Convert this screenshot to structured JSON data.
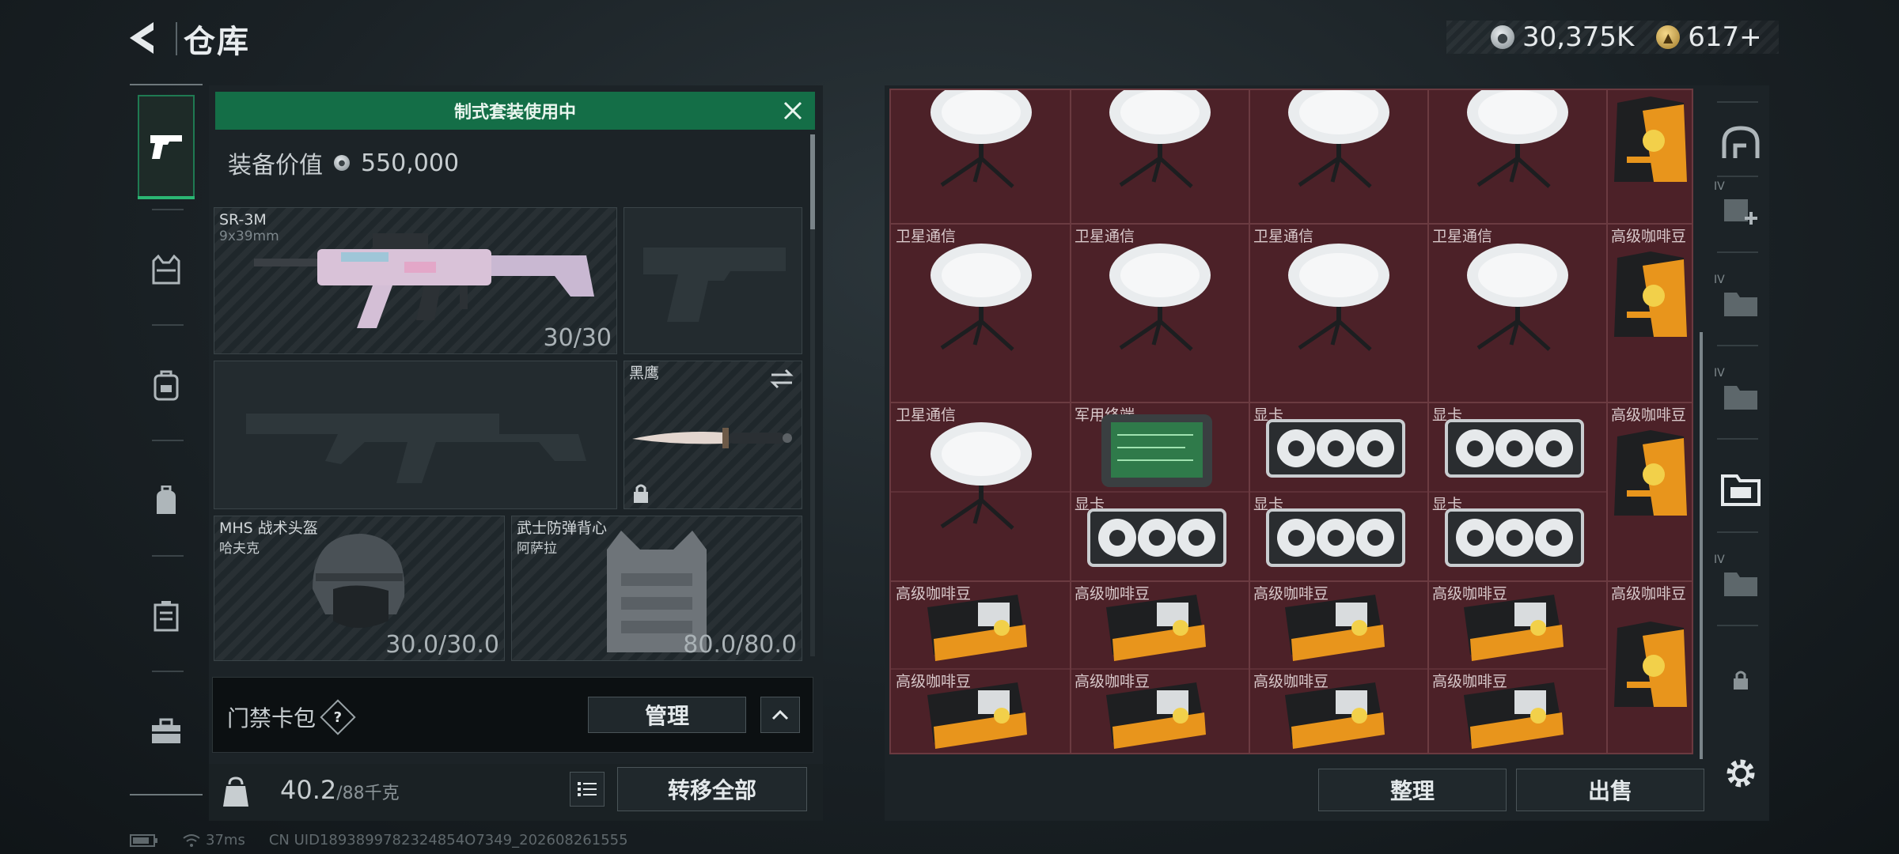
{
  "header": {
    "title": "仓库",
    "silver": "30,375K",
    "gold": "617+"
  },
  "rail": [
    "pistol-tab",
    "vest-tab",
    "backpack-tab",
    "bag-tab",
    "case-tab",
    "toolbox-tab"
  ],
  "loadout": {
    "banner": "制式套装使用中",
    "value_label": "装备价值",
    "value": "550,000",
    "primary": {
      "name": "SR-3M",
      "caliber": "9x39mm",
      "ammo": "30/30"
    },
    "melee": {
      "name": "黑鹰"
    },
    "helmet": {
      "name": "MHS 战术头盔",
      "brand": "哈夫克",
      "durability": "30.0/30.0"
    },
    "armor": {
      "name": "武士防弹背心",
      "brand": "阿萨拉",
      "durability": "80.0/80.0"
    },
    "keybag_label": "门禁卡包",
    "help": "?",
    "manage": "管理",
    "weight_current": "40.2",
    "weight_max": "/88千克",
    "transfer_all": "转移全部"
  },
  "stash": {
    "labels": {
      "satellite": "卫星通信",
      "coffee": "高级咖啡豆",
      "gpu": "显卡",
      "terminal": "军用终端"
    },
    "sort": "整理",
    "sell": "出售"
  },
  "status": {
    "ping": "37ms",
    "uid": "CN UID1893899782324854O7349_202608261555"
  },
  "colors": {
    "accent": "#146e47",
    "grid_bg": "#4c2128"
  }
}
